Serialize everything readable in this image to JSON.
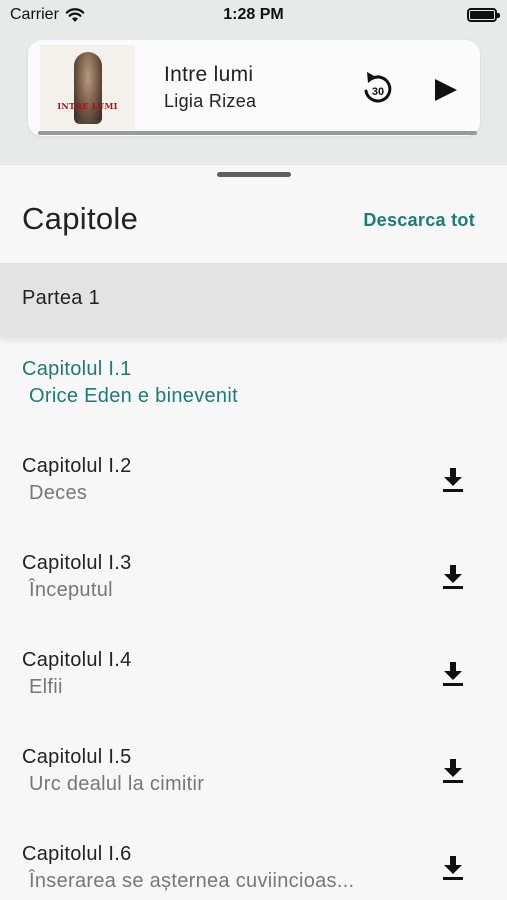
{
  "status_bar": {
    "carrier": "Carrier",
    "time": "1:28 PM"
  },
  "player": {
    "cover": {
      "title": "INTRE LUMI",
      "author": "Ligia Rizea"
    },
    "title": "Intre lumi",
    "author": "Ligia Rizea",
    "rewind_seconds": "30",
    "progress": 0.0
  },
  "chapters_section": {
    "title": "Capitole",
    "download_all_label": "Descarca tot",
    "part_label": "Partea 1",
    "items": [
      {
        "title": "Capitolul I.1",
        "subtitle": "Orice Eden e binevenit",
        "active": true
      },
      {
        "title": "Capitolul I.2",
        "subtitle": "Deces"
      },
      {
        "title": "Capitolul I.3",
        "subtitle": "Începutul"
      },
      {
        "title": "Capitolul I.4",
        "subtitle": "Elfii"
      },
      {
        "title": "Capitolul I.5",
        "subtitle": "Urc dealul la cimitir"
      },
      {
        "title": "Capitolul I.6",
        "subtitle": "Înserarea se așternea cuviincioas..."
      }
    ]
  },
  "colors": {
    "accent": "#1d7a78",
    "header_bg": "#e8eaea",
    "part_bg": "#e3e3e3"
  }
}
